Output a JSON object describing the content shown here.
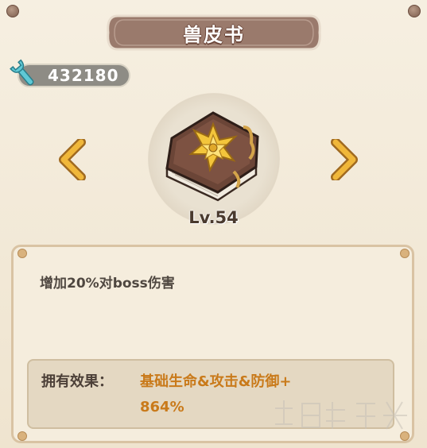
{
  "title": "兽皮书",
  "currency": {
    "icon": "wrench-icon",
    "amount": "432180"
  },
  "item": {
    "name": "兽皮书",
    "icon": "leather-book-icon",
    "level": "Lv.54"
  },
  "navigation": {
    "prev_icon": "chevron-left-icon",
    "next_icon": "chevron-right-icon"
  },
  "description": "增加20%对boss伤害",
  "owned_effect": {
    "label": "拥有效果：",
    "value_line1": "基础生命&攻击&防御+",
    "value_line2": "864%"
  },
  "colors": {
    "banner": "#9a7a6c",
    "accent_text": "#c97a1a",
    "arrow": "#f0b73a",
    "panel_border": "#d9c3a3"
  }
}
